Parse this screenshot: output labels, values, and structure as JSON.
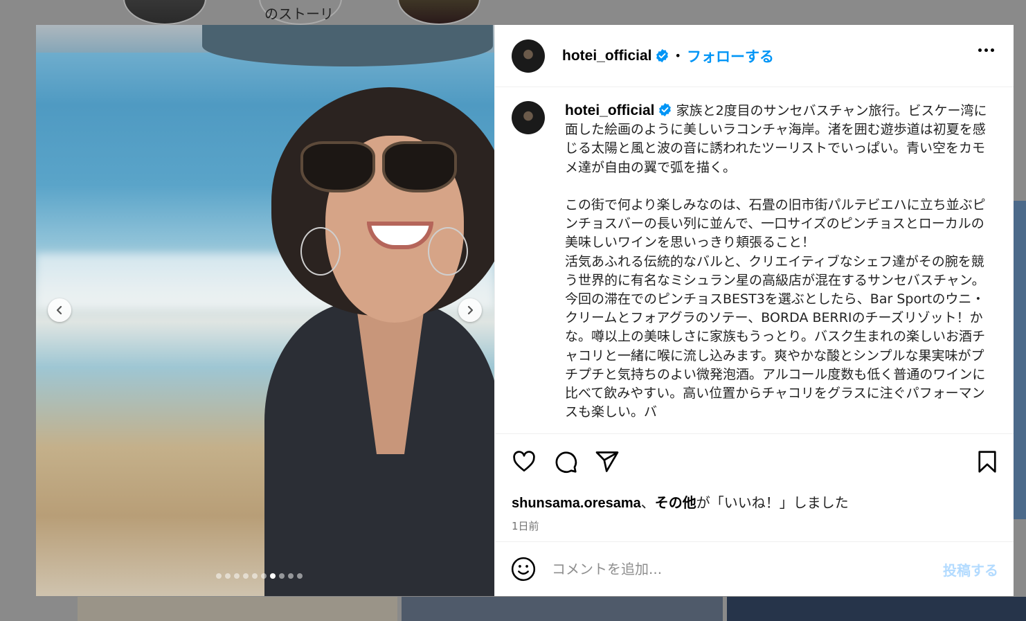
{
  "background": {
    "story_label": "のストーリ"
  },
  "post": {
    "username": "hotei_official",
    "follow_label": "フォローする",
    "separator": "•",
    "caption": "家族と2度目のサンセバスチャン旅行。ビスケー湾に面した絵画のように美しいラコンチャ海岸。渚を囲む遊歩道は初夏を感じる太陽と風と波の音に誘われたツーリストでいっぱい。青い空をカモメ達が自由の翼で弧を描く。\n\nこの街で何より楽しみなのは、石畳の旧市街パルテビエハに立ち並ぶピンチョスバーの長い列に並んで、一口サイズのピンチョスとローカルの美味しいワインを思いっきり頬張ること！\n活気あふれる伝統的なバルと、クリエイティブなシェフ達がその腕を競う世界的に有名なミシュラン星の高級店が混在するサンセバスチャン。\n今回の滞在でのピンチョスBEST3を選ぶとしたら、Bar Sportのウニ・クリームとフォアグラのソテー、BORDA BERRIのチーズリゾット！かな。噂以上の美味しさに家族もうっとり。バスク生まれの楽しいお酒チャコリと一緒に喉に流し込みます。爽やかな酸とシンプルな果実味がプチプチと気持ちのよい微発泡酒。アルコール度数も低く普通のワインに比べて飲みやすい。高い位置からチャコリをグラスに注ぐパフォーマンスも楽しい。バ",
    "likes_user": "shunsama.oresama",
    "likes_sep": "、",
    "likes_others": "その他",
    "likes_suffix": "が「いいね！」しました",
    "timestamp": "1日前",
    "comment_placeholder": "コメントを追加...",
    "post_button": "投稿する",
    "carousel": {
      "total": 10,
      "current_index": 6
    }
  },
  "colors": {
    "accent": "#0095f6",
    "verified": "#0095f6",
    "post_disabled": "#b3dbff"
  },
  "icons": {
    "prev": "chevron-left-icon",
    "next": "chevron-right-icon",
    "like": "heart-icon",
    "comment": "comment-icon",
    "share": "paper-plane-icon",
    "save": "bookmark-icon",
    "emoji": "smiley-icon",
    "more": "more-horizontal-icon",
    "verified": "verified-badge-icon"
  }
}
